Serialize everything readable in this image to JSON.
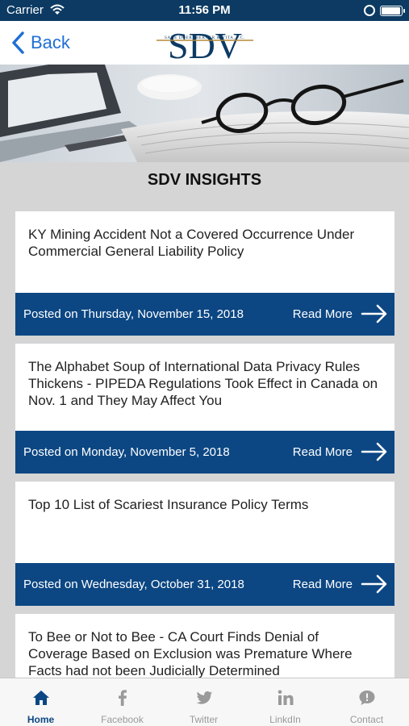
{
  "status_bar": {
    "carrier": "Carrier",
    "time": "11:56 PM",
    "battery_level": 0.95
  },
  "nav": {
    "back_label": "Back",
    "logo_text": "SDV",
    "logo_subtext": "SAXE DOERNBERGER & VITA, P.C."
  },
  "page_title": "SDV INSIGHTS",
  "articles": [
    {
      "title": "KY Mining Accident Not a Covered Occurrence Under Commercial General Liability Policy",
      "date": "Posted on Thursday, November 15, 2018",
      "read_more": "Read More"
    },
    {
      "title": "The Alphabet Soup of International Data Privacy Rules Thickens - PIPEDA Regulations Took Effect in Canada on Nov. 1 and They May Affect You",
      "date": "Posted on Monday, November 5, 2018",
      "read_more": "Read More"
    },
    {
      "title": "Top 10 List of Scariest Insurance Policy Terms",
      "date": "Posted on Wednesday, October 31, 2018",
      "read_more": "Read More"
    },
    {
      "title": "To Bee or Not to Bee - CA Court Finds Denial of Coverage Based on Exclusion was Premature Where Facts had not been Judicially Determined",
      "date": "",
      "read_more": ""
    }
  ],
  "tabs": [
    {
      "label": "Home",
      "icon": "home-icon",
      "active": true
    },
    {
      "label": "Facebook",
      "icon": "facebook-icon",
      "active": false
    },
    {
      "label": "Twitter",
      "icon": "twitter-icon",
      "active": false
    },
    {
      "label": "LinkdIn",
      "icon": "linkedin-icon",
      "active": false
    },
    {
      "label": "Contact",
      "icon": "chat-bubble-icon",
      "active": false
    }
  ],
  "colors": {
    "status_bar": "#0c3a63",
    "card_footer": "#0c4783",
    "accent_link": "#1f6fd6",
    "tab_active": "#0c4783",
    "tab_inactive": "#9a9a9a",
    "background": "#d5d5d5"
  }
}
